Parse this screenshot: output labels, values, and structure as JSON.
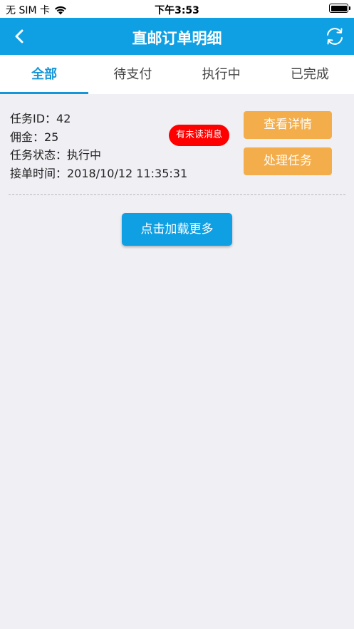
{
  "status_bar": {
    "carrier": "无 SIM 卡",
    "time": "下午3:53"
  },
  "nav": {
    "title": "直邮订单明细",
    "back_icon": "chevron-left-icon",
    "refresh_icon": "refresh-icon"
  },
  "tabs": [
    {
      "label": "全部",
      "active": true
    },
    {
      "label": "待支付",
      "active": false
    },
    {
      "label": "执行中",
      "active": false
    },
    {
      "label": "已完成",
      "active": false
    }
  ],
  "task": {
    "id_line": "任务ID：42",
    "commission_line": "佣金：25",
    "status_line": "任务状态：执行中",
    "time_line": "接单时间：2018/10/12 11:35:31",
    "badge": "有未读消息",
    "view_detail": "查看详情",
    "handle_task": "处理任务"
  },
  "load_more": "点击加载更多",
  "colors": {
    "primary": "#0fa0e4",
    "orange": "#f4ad4b",
    "badge_red": "#ff0000",
    "tab_active": "#1596d8"
  }
}
